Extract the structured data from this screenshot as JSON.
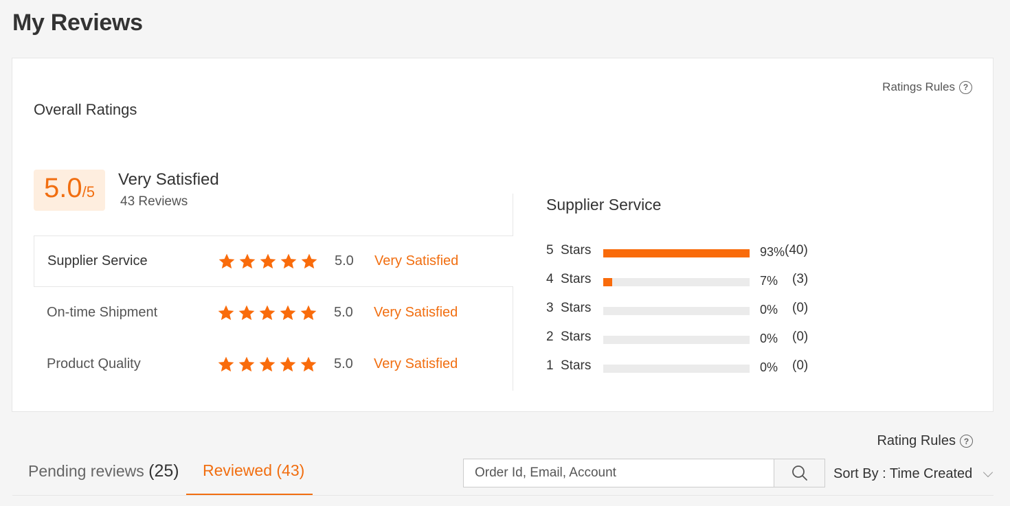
{
  "page": {
    "title": "My Reviews"
  },
  "overall": {
    "title": "Overall Ratings",
    "rules_label": "Ratings Rules",
    "score": "5.0",
    "score_max": "/5",
    "satisfaction": "Very Satisfied",
    "reviews_count_number": "43",
    "reviews_count_text": "Reviews"
  },
  "categories": [
    {
      "name": "Supplier Service",
      "value": "5.0",
      "label": "Very Satisfied",
      "stars": 5
    },
    {
      "name": "On-time Shipment",
      "value": "5.0",
      "label": "Very Satisfied",
      "stars": 5
    },
    {
      "name": "Product Quality",
      "value": "5.0",
      "label": "Very Satisfied",
      "stars": 5
    }
  ],
  "distribution": {
    "title": "Supplier Service",
    "rows": [
      {
        "num": "5",
        "label": "Stars",
        "fraction": 1.0,
        "percent": "93%",
        "count": "(40)"
      },
      {
        "num": "4",
        "label": "Stars",
        "fraction": 0.06,
        "percent": "7%",
        "count": "(3)"
      },
      {
        "num": "3",
        "label": "Stars",
        "fraction": 0,
        "percent": "0%",
        "count": "(0)"
      },
      {
        "num": "2",
        "label": "Stars",
        "fraction": 0,
        "percent": "0%",
        "count": "(0)"
      },
      {
        "num": "1",
        "label": "Stars",
        "fraction": 0,
        "percent": "0%",
        "count": "(0)"
      }
    ]
  },
  "list": {
    "rules_label": "Rating Rules",
    "tabs": [
      {
        "label": "Pending reviews",
        "count": "(25)"
      },
      {
        "label": "Reviewed",
        "count": "(43)"
      }
    ],
    "search": {
      "placeholder": "Order Id, Email, Account"
    },
    "sort": {
      "label": "Sort By : Time Created"
    }
  },
  "colors": {
    "accent": "#f16e10",
    "bar": "#f96b0b",
    "score_bg": "#feeedf"
  },
  "icons": {
    "star": "star-icon",
    "help": "help-icon",
    "search": "search-icon",
    "chevron": "chevron-down-icon"
  }
}
